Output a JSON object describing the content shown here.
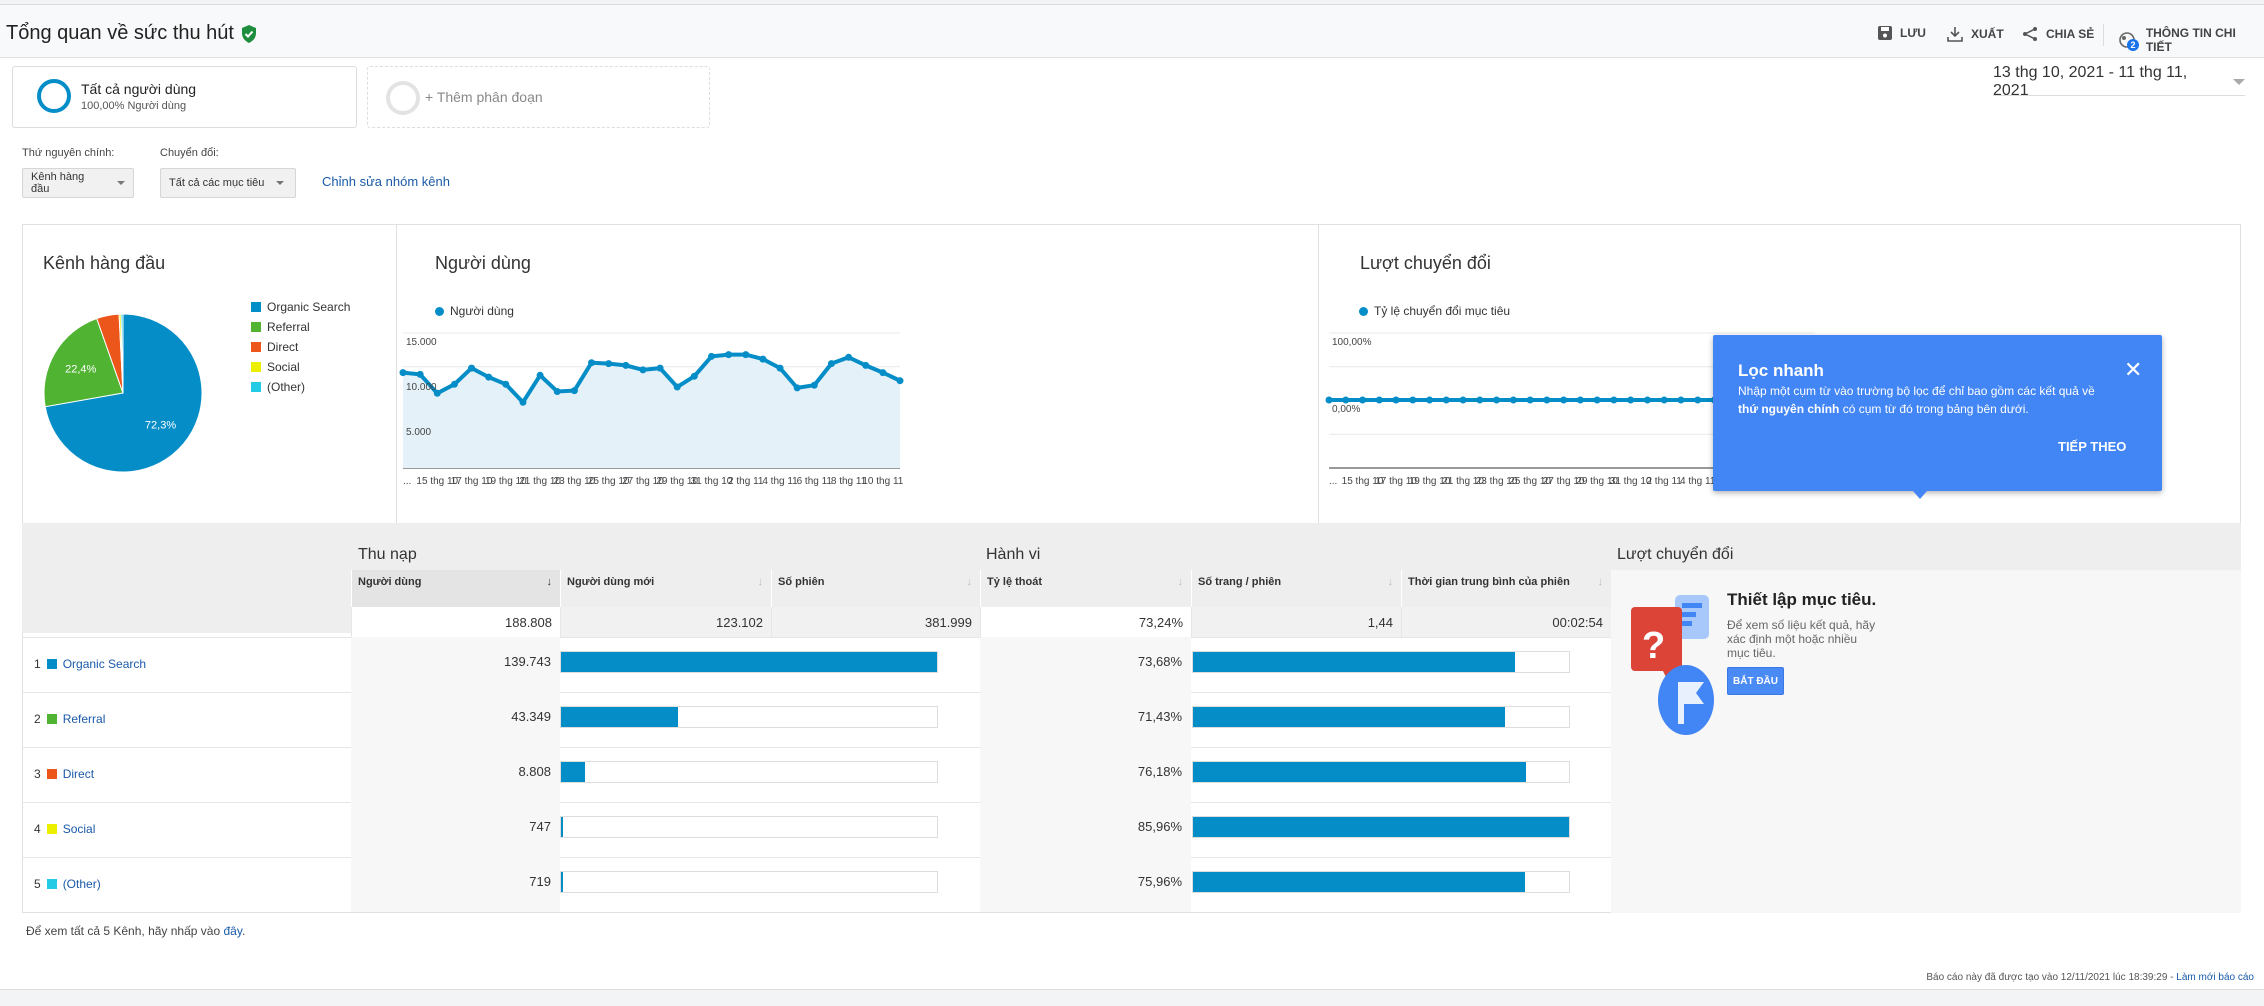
{
  "header": {
    "title": "Tổng quan về sức thu hút",
    "save": "LƯU",
    "export": "XUẤT",
    "share": "CHIA SẺ",
    "insights": "THÔNG TIN CHI TIẾT",
    "insights_badge": "2"
  },
  "segments": {
    "all_users": "Tất cả người dùng",
    "all_users_sub": "100,00% Người dùng",
    "add_segment": "+ Thêm phân đoạn"
  },
  "date_range": "13 thg 10, 2021 - 11 thg 11, 2021",
  "filters": {
    "primary_dim_label": "Thứ nguyên chính:",
    "primary_dim_value": "Kênh hàng đầu",
    "conversion_label": "Chuyển đổi:",
    "conversion_value": "Tất cả các mục tiêu",
    "edit_link": "Chỉnh sửa nhóm kênh"
  },
  "colors": {
    "accent": "#058dc7",
    "organic": "#058dc7",
    "referral": "#50b432",
    "direct": "#ed561b",
    "social": "#edef00",
    "other": "#24cbe5",
    "tooltip": "#4285f4"
  },
  "chart_data": [
    {
      "type": "pie",
      "title": "Kênh hàng đầu",
      "legend_position": "right",
      "slices": [
        {
          "name": "Organic Search",
          "value": 72.3,
          "label": "72,3%"
        },
        {
          "name": "Referral",
          "value": 22.4,
          "label": "22,4%"
        },
        {
          "name": "Direct",
          "value": 4.6
        },
        {
          "name": "Social",
          "value": 0.4
        },
        {
          "name": "(Other)",
          "value": 0.4
        }
      ]
    },
    {
      "type": "area",
      "title": "Người dùng",
      "legend_position": "top-left",
      "series": [
        {
          "name": "Người dùng",
          "values": [
            10600,
            10400,
            8300,
            9300,
            11100,
            10100,
            9300,
            7300,
            10300,
            8500,
            8600,
            11700,
            11600,
            11400,
            10900,
            11100,
            9000,
            10200,
            12400,
            12600,
            12600,
            12100,
            11100,
            8900,
            9200,
            11600,
            12300,
            11400,
            10600,
            9700
          ]
        }
      ],
      "x": [
        "13 thg 10",
        "14 thg 10",
        "15 thg 10",
        "16 thg 10",
        "17 thg 10",
        "18 thg 10",
        "19 thg 10",
        "20 thg 10",
        "21 thg 10",
        "22 thg 10",
        "23 thg 10",
        "24 thg 10",
        "25 thg 10",
        "26 thg 10",
        "27 thg 10",
        "28 thg 10",
        "29 thg 10",
        "30 thg 10",
        "31 thg 10",
        "1 thg 11",
        "2 thg 11",
        "3 thg 11",
        "4 thg 11",
        "5 thg 11",
        "6 thg 11",
        "7 thg 11",
        "8 thg 11",
        "9 thg 11",
        "10 thg 11",
        "11 thg 11"
      ],
      "x_tick_labels": [
        "...",
        "15 thg 10",
        "17 thg 10",
        "19 thg 10",
        "21 thg 10",
        "23 thg 10",
        "25 thg 10",
        "27 thg 10",
        "29 thg 10",
        "31 thg 10",
        "2 thg 11",
        "4 thg 11",
        "6 thg 11",
        "8 thg 11",
        "10 thg 11"
      ],
      "y_tick_labels": [
        "15.000",
        "10.000",
        "5.000"
      ],
      "ylim": [
        0,
        15000
      ],
      "grid": true
    },
    {
      "type": "line",
      "title": "Lượt chuyển đổi",
      "legend_position": "top-left",
      "series": [
        {
          "name": "Tỷ lệ chuyển đổi mục tiêu",
          "values": [
            0,
            0,
            0,
            0,
            0,
            0,
            0,
            0,
            0,
            0,
            0,
            0,
            0,
            0,
            0,
            0,
            0,
            0,
            0,
            0,
            0,
            0,
            0,
            0,
            0,
            0,
            0,
            0,
            0,
            0
          ]
        }
      ],
      "x_tick_labels": [
        "...",
        "15 thg 10",
        "17 thg 10",
        "19 thg 10",
        "21 thg 10",
        "23 thg 10",
        "25 thg 10",
        "27 thg 10",
        "29 thg 10",
        "31 thg 10",
        "2 thg 11",
        "4 thg 11",
        "6 thg 11",
        "8 thg 11",
        "10 thg 11"
      ],
      "y_tick_labels": [
        "100,00%",
        "0,00%"
      ],
      "ylim": [
        0,
        100
      ],
      "grid": true
    }
  ],
  "table": {
    "groups": {
      "acquisition": "Thu nạp",
      "behavior": "Hành vi",
      "conversions": "Lượt chuyển đổi"
    },
    "columns": [
      "Người dùng",
      "Người dùng mới",
      "Số phiên",
      "Tỷ lệ thoát",
      "Số trang / phiên",
      "Thời gian trung bình của phiên"
    ],
    "totals": [
      "188.808",
      "123.102",
      "381.999",
      "73,24%",
      "1,44",
      "00:02:54"
    ],
    "rows": [
      {
        "rank": "1",
        "name": "Organic Search",
        "color": "#058dc7",
        "users": "139.743",
        "users_num": 139743,
        "bounce": "73,68%",
        "bounce_num": 73.68
      },
      {
        "rank": "2",
        "name": "Referral",
        "color": "#50b432",
        "users": "43.349",
        "users_num": 43349,
        "bounce": "71,43%",
        "bounce_num": 71.43
      },
      {
        "rank": "3",
        "name": "Direct",
        "color": "#ed561b",
        "users": "8.808",
        "users_num": 8808,
        "bounce": "76,18%",
        "bounce_num": 76.18
      },
      {
        "rank": "4",
        "name": "Social",
        "color": "#edef00",
        "users": "747",
        "users_num": 747,
        "bounce": "85,96%",
        "bounce_num": 85.96
      },
      {
        "rank": "5",
        "name": "(Other)",
        "color": "#24cbe5",
        "users": "719",
        "users_num": 719,
        "bounce": "75,96%",
        "bounce_num": 75.96
      }
    ],
    "goal": {
      "title": "Thiết lập mục tiêu.",
      "text": "Để xem số liệu kết quả, hãy xác định một hoặc nhiều mục tiêu.",
      "button": "BẮT ĐẦU"
    }
  },
  "tooltip": {
    "title": "Lọc nhanh",
    "text_a": "Nhập một cụm từ vào trường bộ lọc để chỉ bao gồm các kết quả về ",
    "text_bold": "thứ nguyên chính",
    "text_b": " có cụm từ đó trong bảng bên dưới.",
    "next": "TIẾP THEO"
  },
  "footer": {
    "see_all": "Để xem tất cả 5 Kênh, hãy nhấp vào ",
    "see_all_link": "đây",
    "see_all_end": ".",
    "report_time": "Báo cáo này đã được tạo vào 12/11/2021 lúc 18:39:29 - ",
    "refresh": "Làm mới báo cáo"
  }
}
